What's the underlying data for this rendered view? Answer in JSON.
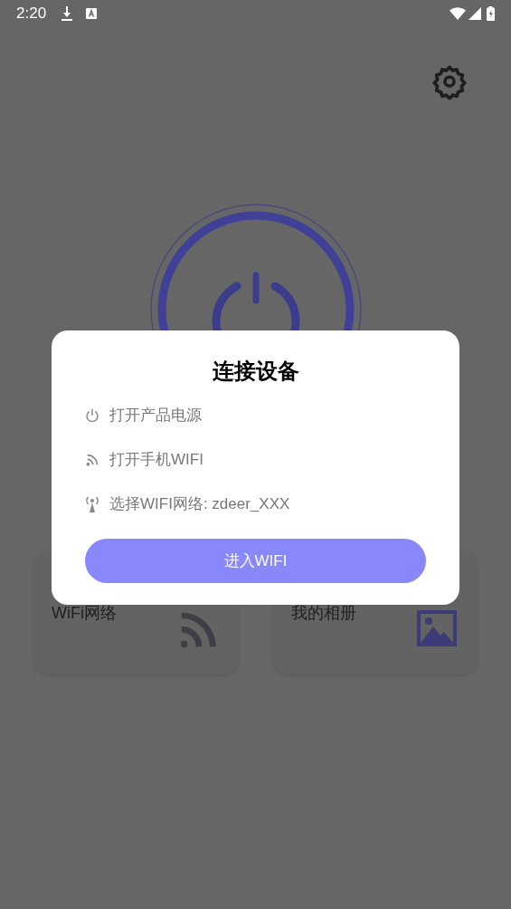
{
  "status_bar": {
    "time": "2:20"
  },
  "cards": [
    {
      "label": "WiFi网络",
      "kind": "wifi"
    },
    {
      "label": "我的相册",
      "kind": "album"
    }
  ],
  "dialog": {
    "title": "连接设备",
    "steps": [
      {
        "text": "打开产品电源",
        "kind": "power"
      },
      {
        "text": "打开手机WIFI",
        "kind": "wifi"
      },
      {
        "text": "选择WIFI网络: zdeer_XXX",
        "kind": "antenna"
      }
    ],
    "button": "进入WIFI"
  }
}
